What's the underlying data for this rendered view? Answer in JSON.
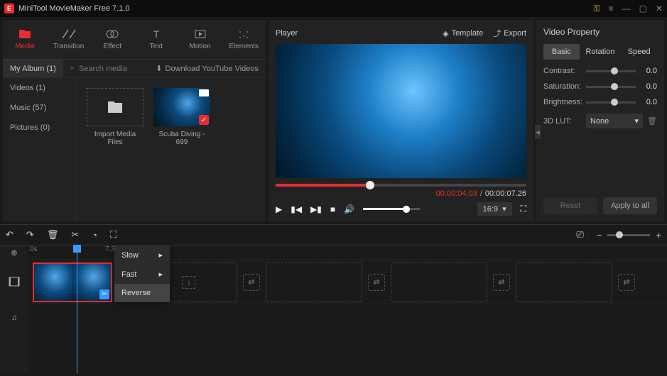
{
  "title": "MiniTool MovieMaker Free 7.1.0",
  "toolbar": [
    {
      "label": "Media",
      "active": true
    },
    {
      "label": "Transition",
      "active": false
    },
    {
      "label": "Effect",
      "active": false
    },
    {
      "label": "Text",
      "active": false
    },
    {
      "label": "Motion",
      "active": false
    },
    {
      "label": "Elements",
      "active": false
    }
  ],
  "album_tab": "My Album (1)",
  "search_placeholder": "Search media",
  "download_label": "Download YouTube Videos",
  "categories": [
    {
      "label": "Videos (1)"
    },
    {
      "label": "Music (57)"
    },
    {
      "label": "Pictures (0)"
    }
  ],
  "import_label": "Import Media Files",
  "clip_name": "Scuba Diving - 699",
  "player": {
    "title": "Player",
    "template": "Template",
    "export": "Export",
    "current": "00:00:04.03",
    "total": "00:00:07.26",
    "aspect": "16:9"
  },
  "props": {
    "title": "Video Property",
    "tabs": [
      "Basic",
      "Rotation",
      "Speed"
    ],
    "rows": [
      {
        "label": "Contrast:",
        "value": "0.0"
      },
      {
        "label": "Saturation:",
        "value": "0.0"
      },
      {
        "label": "Brightness:",
        "value": "0.0"
      }
    ],
    "lut_label": "3D LUT:",
    "lut_value": "None",
    "reset": "Reset",
    "apply": "Apply to all"
  },
  "timeline": {
    "marks": [
      "0s",
      "7.3s"
    ],
    "menu": [
      "Slow",
      "Fast",
      "Reverse"
    ]
  }
}
